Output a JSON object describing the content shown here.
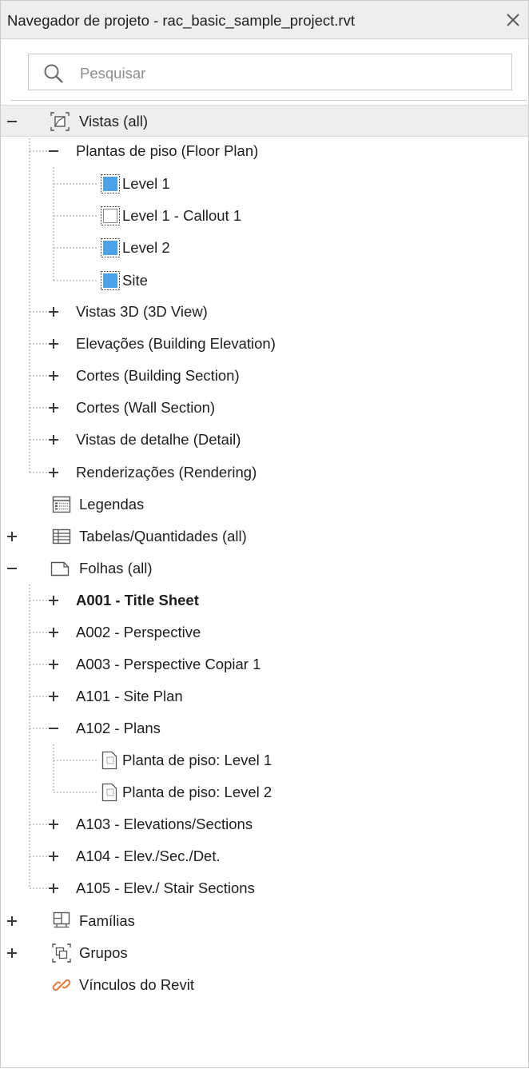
{
  "window": {
    "title": "Navegador de projeto - rac_basic_sample_project.rvt",
    "close_icon": "close-icon"
  },
  "search": {
    "placeholder": "Pesquisar",
    "icon": "search-icon"
  },
  "tree": {
    "views": {
      "label": "Vistas (all)",
      "expanded": true,
      "selected": true,
      "children": {
        "floor_plans": {
          "label": "Plantas de piso (Floor Plan)",
          "expanded": true,
          "items": [
            "Level 1",
            "Level 1 - Callout 1",
            "Level 2",
            "Site"
          ]
        },
        "views_3d": "Vistas 3D (3D View)",
        "elevations": "Elevações (Building Elevation)",
        "building_sections": "Cortes (Building Section)",
        "wall_sections": "Cortes (Wall Section)",
        "detail_views": "Vistas de detalhe (Detail)",
        "renderings": "Renderizações (Rendering)"
      }
    },
    "legends": "Legendas",
    "schedules": "Tabelas/Quantidades (all)",
    "sheets": {
      "label": "Folhas (all)",
      "expanded": true,
      "items": {
        "a001": "A001 - Title Sheet",
        "a002": "A002 - Perspective",
        "a003": "A003 - Perspective Copiar 1",
        "a101": "A101 - Site Plan",
        "a102": "A102 - Plans",
        "a102_children": [
          "Planta de piso: Level 1",
          "Planta de piso: Level 2"
        ],
        "a103": "A103 - Elevations/Sections",
        "a104": "A104 - Elev./Sec./Det.",
        "a105": "A105 - Elev./ Stair Sections"
      }
    },
    "families": "Famílias",
    "groups": "Grupos",
    "revit_links": "Vínculos do Revit"
  },
  "colors": {
    "view_fill": "#4aa3e8",
    "link_orange": "#e8783c",
    "selection_bg": "#eeeeee"
  }
}
